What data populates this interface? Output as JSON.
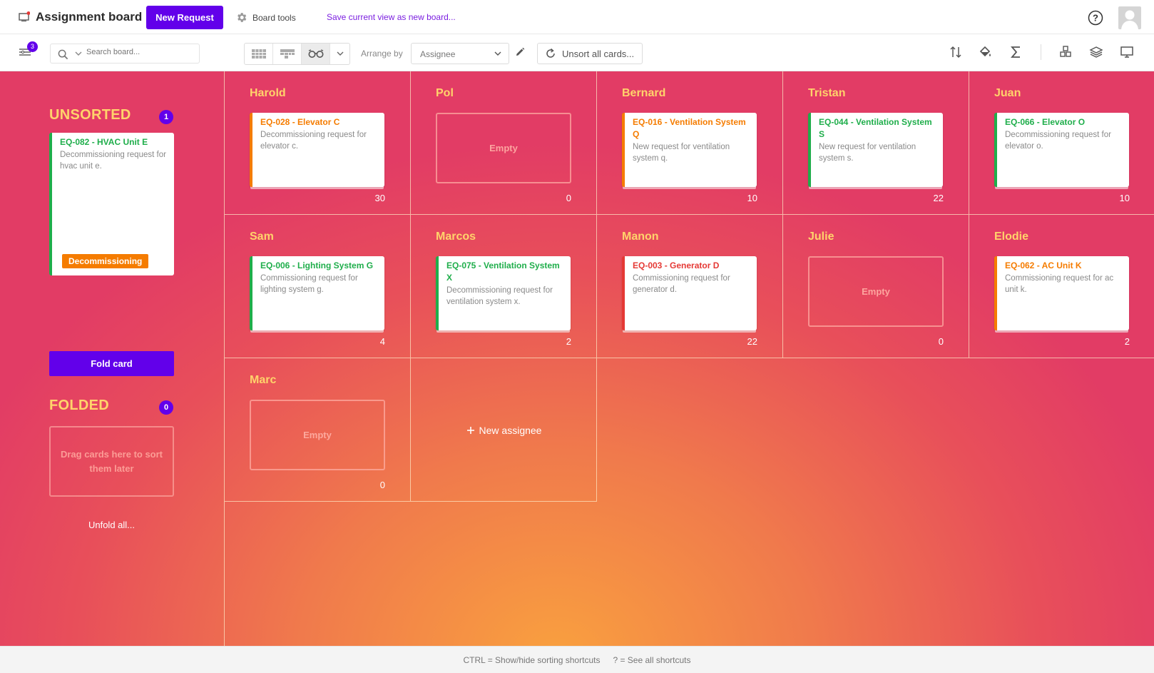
{
  "header": {
    "title": "Assignment board",
    "new_request": "New Request",
    "board_tools": "Board tools",
    "save_view": "Save current view as new board..."
  },
  "toolbar": {
    "filter_badge": "3",
    "search_placeholder": "Search board...",
    "arrange_label": "Arrange by",
    "arrange_value": "Assignee",
    "unsort_label": "Unsort all cards..."
  },
  "sidebar": {
    "unsorted_title": "UNSORTED",
    "unsorted_count": "1",
    "unsorted_card": {
      "title": "EQ-082 - HVAC Unit E",
      "desc": "Decommissioning request for hvac unit e.",
      "tag": "Decommissioning"
    },
    "fold_button": "Fold card",
    "folded_title": "FOLDED",
    "folded_count": "0",
    "folded_placeholder": "Drag cards here to sort them later",
    "unfold_all": "Unfold all..."
  },
  "columns": [
    {
      "name": "Harold",
      "count": "30",
      "card": {
        "title": "EQ-028 - Elevator C",
        "desc": "Decommissioning request for elevator c.",
        "color": "#f57c00"
      }
    },
    {
      "name": "Pol",
      "count": "0",
      "empty": "Empty"
    },
    {
      "name": "Bernard",
      "count": "10",
      "card": {
        "title": "EQ-016 - Ventilation System Q",
        "desc": "New request for ventilation system q.",
        "color": "#f57c00"
      }
    },
    {
      "name": "Tristan",
      "count": "22",
      "card": {
        "title": "EQ-044 - Ventilation System S",
        "desc": "New request for ventilation system s.",
        "color": "#1fae4b"
      }
    },
    {
      "name": "Juan",
      "count": "10",
      "card": {
        "title": "EQ-066 - Elevator O",
        "desc": "Decommissioning request for elevator o.",
        "color": "#1fae4b"
      }
    },
    {
      "name": "Sam",
      "count": "4",
      "card": {
        "title": "EQ-006 - Lighting System G",
        "desc": "Commissioning request for lighting system g.",
        "color": "#1fae4b"
      }
    },
    {
      "name": "Marcos",
      "count": "2",
      "card": {
        "title": "EQ-075 - Ventilation System X",
        "desc": "Decommissioning request for ventilation system x.",
        "color": "#1fae4b"
      }
    },
    {
      "name": "Manon",
      "count": "22",
      "card": {
        "title": "EQ-003 - Generator D",
        "desc": "Commissioning request for generator d.",
        "color": "#e53935"
      }
    },
    {
      "name": "Julie",
      "count": "0",
      "empty": "Empty"
    },
    {
      "name": "Elodie",
      "count": "2",
      "card": {
        "title": "EQ-062 - AC Unit K",
        "desc": "Commissioning request for ac unit k.",
        "color": "#f57c00"
      }
    },
    {
      "name": "Marc",
      "count": "0",
      "empty": "Empty"
    }
  ],
  "new_assignee": "New assignee",
  "footer": {
    "shortcut1": "CTRL = Show/hide sorting shortcuts",
    "shortcut2": "? = See all shortcuts"
  }
}
